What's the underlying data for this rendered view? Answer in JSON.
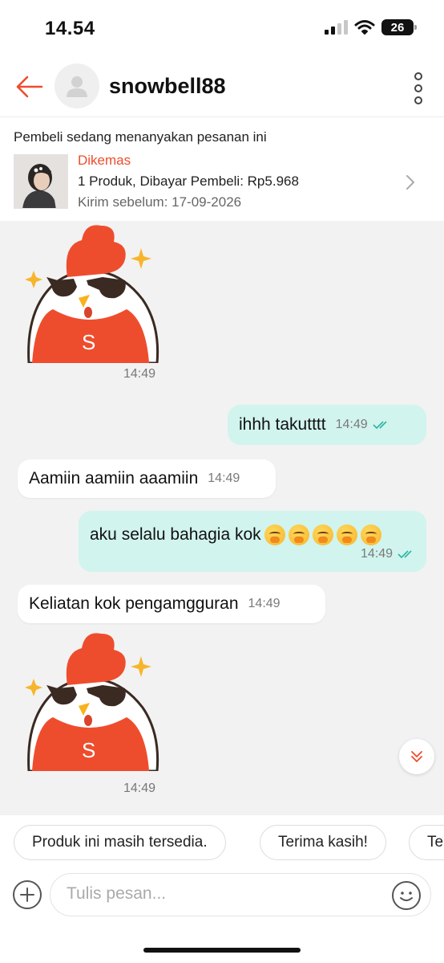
{
  "status_bar": {
    "time": "14.54",
    "battery": "26"
  },
  "header": {
    "username": "snowbell88"
  },
  "order": {
    "note": "Pembeli sedang menanyakan pesanan ini",
    "status": "Dikemas",
    "summary": "1 Produk, Dibayar Pembeli: Rp5.968",
    "ship_by": "Kirim sebelum: 17-09-2026"
  },
  "messages": [
    {
      "type": "sticker",
      "time": "14:49",
      "sticker_letter": "S"
    },
    {
      "type": "out",
      "text": "ihhh takutttt",
      "time": "14:49"
    },
    {
      "type": "in",
      "text": "Aamiin aamiin aaamiin",
      "time": "14:49"
    },
    {
      "type": "out",
      "text": "aku selalu bahagia kok",
      "emoji_count": 5,
      "emoji": "face-with-hand-over-mouth",
      "time": "14:49"
    },
    {
      "type": "in",
      "text": "Keliatan kok pengamgguran",
      "time": "14:49"
    },
    {
      "type": "sticker",
      "time": "14:49",
      "sticker_letter": "S"
    }
  ],
  "quick_replies": [
    "Produk ini masih tersedia.",
    "Terima kasih!",
    "Te"
  ],
  "composer": {
    "placeholder": "Tulis pesan..."
  },
  "colors": {
    "accent": "#ee4d2d",
    "outgoing_bubble": "#d1f4ee",
    "chat_bg": "#f2f2f2",
    "read_tick": "#2bb5a4"
  }
}
